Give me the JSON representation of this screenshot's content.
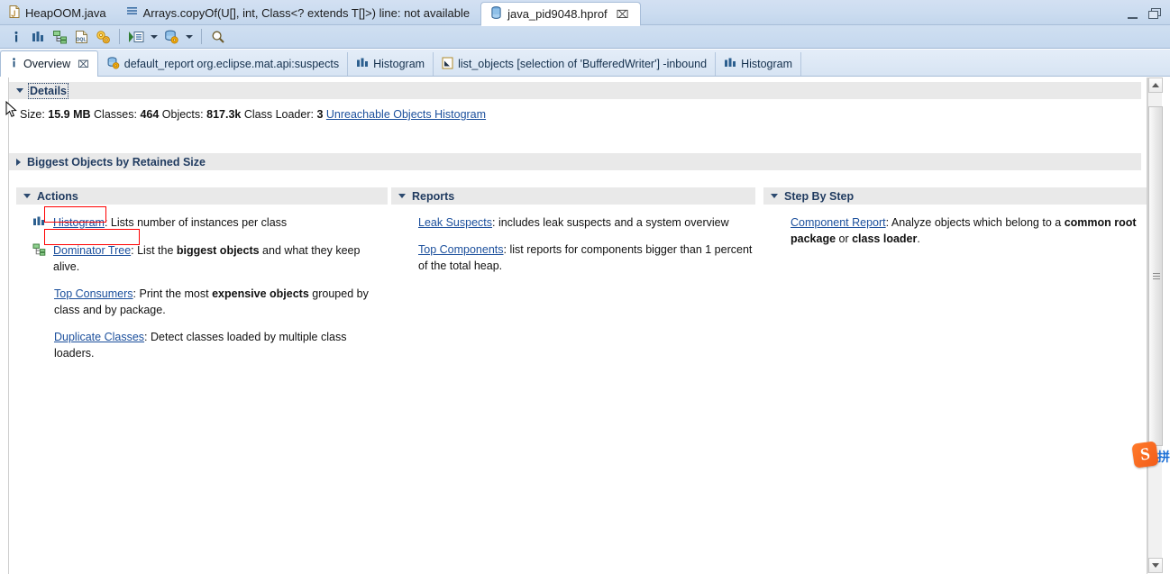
{
  "window": {
    "minimize_label": "Minimize",
    "maximize_label": "Restore"
  },
  "editor_tabs": [
    {
      "label": "HeapOOM.java",
      "icon": "java-file-icon",
      "active": false,
      "closable": false
    },
    {
      "label": "Arrays.copyOf(U[], int, Class<? extends T[]>) line: not available",
      "icon": "stack-frame-icon",
      "active": false,
      "closable": false
    },
    {
      "label": "java_pid9048.hprof",
      "icon": "heap-dump-icon",
      "active": true,
      "closable": true,
      "close_glyph": "⌧"
    }
  ],
  "toolbar": {
    "buttons": [
      {
        "name": "overview-info-icon",
        "tooltip": "Overview"
      },
      {
        "name": "histogram-icon",
        "tooltip": "Histogram"
      },
      {
        "name": "dominator-tree-icon",
        "tooltip": "Dominator Tree"
      },
      {
        "name": "oql-icon",
        "tooltip": "OQL",
        "label": "OQL"
      },
      {
        "name": "calculate-retained-size-icon",
        "tooltip": "Calculate Retained Size"
      },
      {
        "name": "run-expert-system-icon",
        "tooltip": "Run Expert System Test"
      },
      {
        "name": "query-browser-icon",
        "tooltip": "Query Browser"
      },
      {
        "name": "find-icon",
        "tooltip": "Find"
      }
    ],
    "dropdown_glyph": "▾"
  },
  "view_tabs": [
    {
      "label": "Overview",
      "icon": "info-icon",
      "active": true,
      "closable": true,
      "close_glyph": "⌧"
    },
    {
      "label": "default_report  org.eclipse.mat.api:suspects",
      "icon": "report-icon",
      "active": false,
      "closable": false
    },
    {
      "label": "Histogram",
      "icon": "histogram-icon",
      "active": false,
      "closable": false
    },
    {
      "label": "list_objects [selection of 'BufferedWriter'] -inbound",
      "icon": "list-objects-icon",
      "active": false,
      "closable": false
    },
    {
      "label": "Histogram",
      "icon": "histogram-icon",
      "active": false,
      "closable": false
    }
  ],
  "sections": {
    "details": {
      "title": "Details",
      "expanded": true,
      "focused": true,
      "stats": [
        {
          "label": "Size:",
          "value": "15.9 MB"
        },
        {
          "label": "Classes:",
          "value": "464"
        },
        {
          "label": "Objects:",
          "value": "817.3k"
        },
        {
          "label": "Class Loader:",
          "value": "3"
        }
      ],
      "link": "Unreachable Objects Histogram"
    },
    "biggest_objects": {
      "title": "Biggest Objects by Retained Size",
      "expanded": false
    },
    "actions": {
      "title": "Actions",
      "expanded": true,
      "items": [
        {
          "icon": "histogram-icon",
          "link": "Histogram",
          "separator": ": ",
          "desc_parts": [
            {
              "text": "Lists number of instances per class",
              "bold": false
            }
          ],
          "highlighted": true
        },
        {
          "icon": "dominator-tree-icon",
          "link": "Dominator Tree",
          "separator": ": ",
          "desc_parts": [
            {
              "text": "List the ",
              "bold": false
            },
            {
              "text": "biggest objects",
              "bold": true
            },
            {
              "text": " and what they keep alive.",
              "bold": false
            }
          ],
          "highlighted": true
        },
        {
          "icon": "none",
          "link": "Top Consumers",
          "separator": ": ",
          "desc_parts": [
            {
              "text": "Print the most ",
              "bold": false
            },
            {
              "text": "expensive objects",
              "bold": true
            },
            {
              "text": " grouped by class and by package.",
              "bold": false
            }
          ],
          "highlighted": false
        },
        {
          "icon": "none",
          "link": "Duplicate Classes",
          "separator": ": ",
          "desc_parts": [
            {
              "text": "Detect classes loaded by multiple class loaders.",
              "bold": false
            }
          ],
          "highlighted": false
        }
      ]
    },
    "reports": {
      "title": "Reports",
      "expanded": true,
      "items": [
        {
          "icon": "none",
          "link": "Leak Suspects",
          "separator": ": ",
          "desc_parts": [
            {
              "text": "includes leak suspects and a system overview",
              "bold": false
            }
          ],
          "highlighted": false
        },
        {
          "icon": "none",
          "link": "Top Components",
          "separator": ": ",
          "desc_parts": [
            {
              "text": "list reports for components bigger than 1 percent of the total heap.",
              "bold": false
            }
          ],
          "highlighted": false
        }
      ]
    },
    "step_by_step": {
      "title": "Step By Step",
      "expanded": true,
      "items": [
        {
          "icon": "none",
          "link": "Component Report",
          "separator": ": ",
          "desc_parts": [
            {
              "text": "Analyze objects which belong to a ",
              "bold": false
            },
            {
              "text": "common root package",
              "bold": true
            },
            {
              "text": " or ",
              "bold": false
            },
            {
              "text": "class loader",
              "bold": true
            },
            {
              "text": ".",
              "bold": false
            }
          ],
          "highlighted": false
        }
      ]
    }
  },
  "scrollbar": {
    "up_glyph": "▲",
    "down_glyph": "▼",
    "thumb_top_pct": 3,
    "thumb_height_pct": 73
  },
  "ime_badge": {
    "letter": "S",
    "glyph": "拼"
  },
  "colors": {
    "link": "#1b4f9c",
    "section_header_text": "#1f3a5f",
    "section_header_bg": "#e9e9e9",
    "highlight_box": "#ff0000",
    "tab_bar": "#cbdcf0",
    "accent": "#3b6ea5"
  }
}
